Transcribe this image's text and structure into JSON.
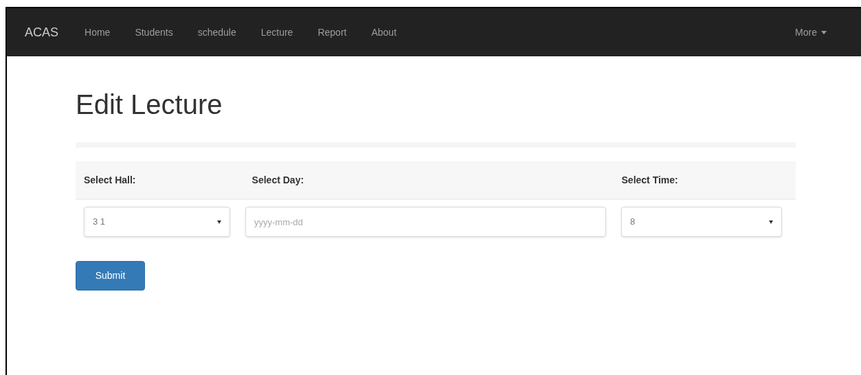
{
  "navbar": {
    "brand": "ACAS",
    "links": [
      "Home",
      "Students",
      "schedule",
      "Lecture",
      "Report",
      "About"
    ],
    "dropdown": "More"
  },
  "page": {
    "title": "Edit Lecture"
  },
  "form": {
    "columns": [
      {
        "label": "Select Hall:",
        "kind": "select",
        "value": "3 1"
      },
      {
        "label": "Select Day:",
        "kind": "date",
        "placeholder": "yyyy-mm-dd"
      },
      {
        "label": "Select Time:",
        "kind": "select",
        "value": "8"
      }
    ],
    "submit": "Submit"
  }
}
